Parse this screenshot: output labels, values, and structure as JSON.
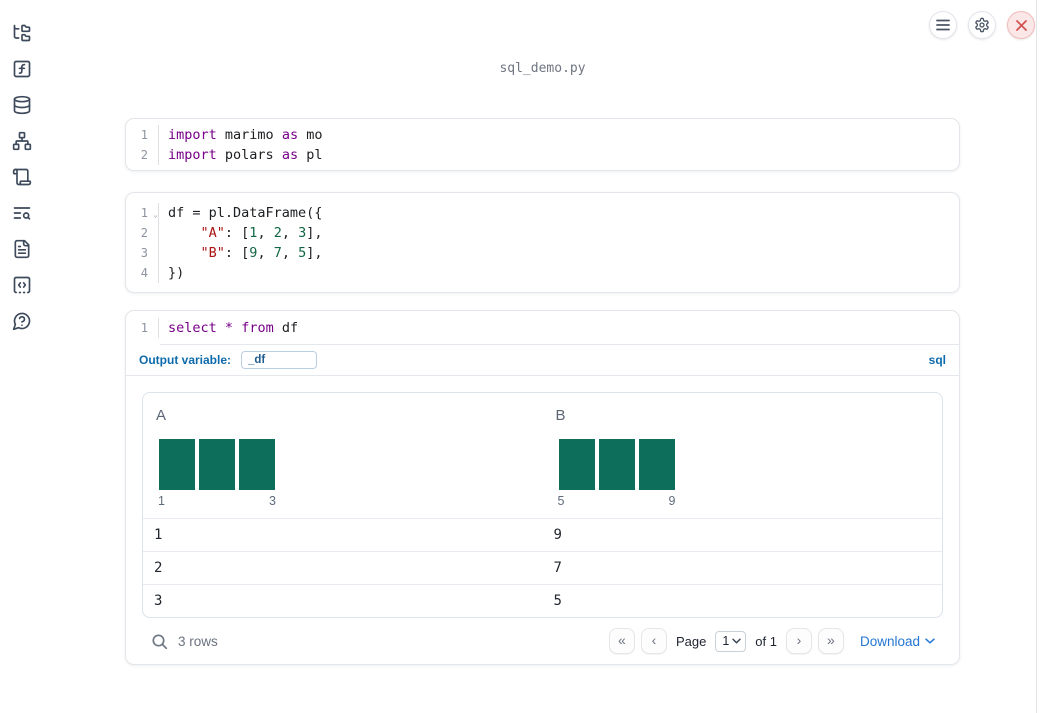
{
  "app": {
    "title": "sql_demo.py"
  },
  "colors": {
    "histogram_bar": "#0E6E5C",
    "syntax_keyword": "#770088",
    "syntax_string": "#AA1111",
    "syntax_number": "#116644",
    "accent_blue": "#0E6BAB",
    "link_blue": "#2476D2",
    "danger_red": "#D25353"
  },
  "icons": {
    "fold_chevron": "⌄"
  },
  "sidebar": {
    "items": [
      {
        "id": "file-explorer"
      },
      {
        "id": "variables"
      },
      {
        "id": "datasources"
      },
      {
        "id": "dependency-graph"
      },
      {
        "id": "logs"
      },
      {
        "id": "scratchpad-search"
      },
      {
        "id": "documentation"
      },
      {
        "id": "snippets"
      },
      {
        "id": "help"
      }
    ]
  },
  "cells": [
    {
      "lines": [
        {
          "n": "1",
          "tokens": [
            [
              "kw",
              "import"
            ],
            [
              "pl",
              " marimo "
            ],
            [
              "kw",
              "as"
            ],
            [
              "pl",
              " mo"
            ]
          ]
        },
        {
          "n": "2",
          "tokens": [
            [
              "kw",
              "import"
            ],
            [
              "pl",
              " polars "
            ],
            [
              "kw",
              "as"
            ],
            [
              "pl",
              " pl"
            ]
          ]
        }
      ]
    },
    {
      "lines": [
        {
          "n": "1",
          "fold": true,
          "tokens": [
            [
              "pl",
              "df = pl.DataFrame({"
            ]
          ]
        },
        {
          "n": "2",
          "tokens": [
            [
              "pl",
              "    "
            ],
            [
              "str",
              "\"A\""
            ],
            [
              "pl",
              ": ["
            ],
            [
              "num",
              "1"
            ],
            [
              "pl",
              ", "
            ],
            [
              "num",
              "2"
            ],
            [
              "pl",
              ", "
            ],
            [
              "num",
              "3"
            ],
            [
              "pl",
              "],"
            ]
          ]
        },
        {
          "n": "3",
          "tokens": [
            [
              "pl",
              "    "
            ],
            [
              "str",
              "\"B\""
            ],
            [
              "pl",
              ": ["
            ],
            [
              "num",
              "9"
            ],
            [
              "pl",
              ", "
            ],
            [
              "num",
              "7"
            ],
            [
              "pl",
              ", "
            ],
            [
              "num",
              "5"
            ],
            [
              "pl",
              "],"
            ]
          ]
        },
        {
          "n": "4",
          "tokens": [
            [
              "pl",
              "})"
            ]
          ]
        }
      ]
    },
    {
      "lines": [
        {
          "n": "1",
          "tokens": [
            [
              "kw",
              "select"
            ],
            [
              "pl",
              " "
            ],
            [
              "kw",
              "*"
            ],
            [
              "pl",
              " "
            ],
            [
              "kw",
              "from"
            ],
            [
              "pl",
              " df"
            ]
          ]
        }
      ]
    }
  ],
  "sql_cell": {
    "output_variable_label": "Output variable:",
    "output_variable_value": "_df",
    "language_badge": "sql"
  },
  "table": {
    "columns": [
      {
        "header": "A",
        "hist": {
          "bars": [
            1,
            1,
            1
          ],
          "min_label": "1",
          "max_label": "3"
        }
      },
      {
        "header": "B",
        "hist": {
          "bars": [
            1,
            1,
            1
          ],
          "min_label": "5",
          "max_label": "9"
        }
      }
    ],
    "rows": [
      [
        "1",
        "9"
      ],
      [
        "2",
        "7"
      ],
      [
        "3",
        "5"
      ]
    ],
    "footer": {
      "row_count": "3 rows",
      "page_label": "Page",
      "page_value": "1",
      "of_label": "of 1",
      "download_label": "Download",
      "pagination": {
        "first": "«",
        "prev": "‹",
        "next": "›",
        "last": "»"
      }
    }
  }
}
